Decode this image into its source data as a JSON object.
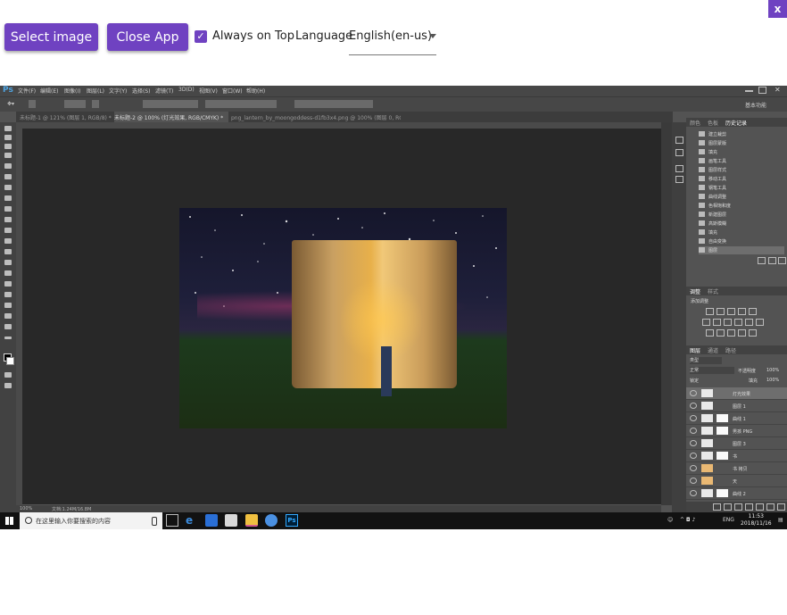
{
  "app_bar": {
    "select_image_label": "Select image",
    "close_app_label": "Close App",
    "always_on_top_label": "Always on Top",
    "always_on_top_checked": true,
    "language_label": "Language",
    "language_value": "English(en-us)",
    "close_label": "x",
    "accent_color": "#6f42c1"
  },
  "photoshop": {
    "logo": "Ps",
    "menu": [
      "文件(F)",
      "编辑(E)",
      "图像(I)",
      "图层(L)",
      "文字(Y)",
      "选择(S)",
      "滤镜(T)",
      "3D(D)",
      "视图(V)",
      "窗口(W)",
      "帮助(H)"
    ],
    "tabs": [
      "未标题-1 @ 121% (图层 1, RGB/8) *",
      "未标题-2 @ 100% (灯光效果, RGB/CMYK) *",
      "png_lantern_by_moongoddess-d1fb3x4.png @ 100% (图层 0, RGB/8#)"
    ],
    "workspace": "基本功能",
    "status_zoom": "100%",
    "status_doc": "文档:1.24M/16.8M",
    "panels": {
      "history_tabs": [
        "颜色",
        "色板",
        "历史记录"
      ],
      "history_items": [
        "建立裁剪",
        "图层蒙版",
        "填充",
        "画笔工具",
        "图层样式",
        "移动工具",
        "钢笔工具",
        "曲线调整",
        "色相饱和度",
        "新建图层",
        "高斯模糊",
        "填充",
        "自由变换",
        "图层"
      ],
      "adjust_tabs": [
        "调整",
        "样式"
      ],
      "adjust_title": "添加调整",
      "layers_tabs": [
        "图层",
        "通道",
        "路径"
      ],
      "layers_kind": "类型",
      "blend_mode": "正常",
      "opacity_label": "不透明度",
      "opacity": "100%",
      "lock_label": "锁定",
      "fill_label": "填充",
      "fill": "100%",
      "layers": [
        "灯光效果",
        "图层 1",
        "曲线 1",
        "男孩 PNG",
        "图层 3",
        "书",
        "书 拷贝",
        "天",
        "曲线 2"
      ]
    }
  },
  "taskbar": {
    "search_placeholder": "在这里输入你要搜索的内容",
    "tray": "ENG",
    "time": "11:53",
    "date": "2018/11/16"
  }
}
